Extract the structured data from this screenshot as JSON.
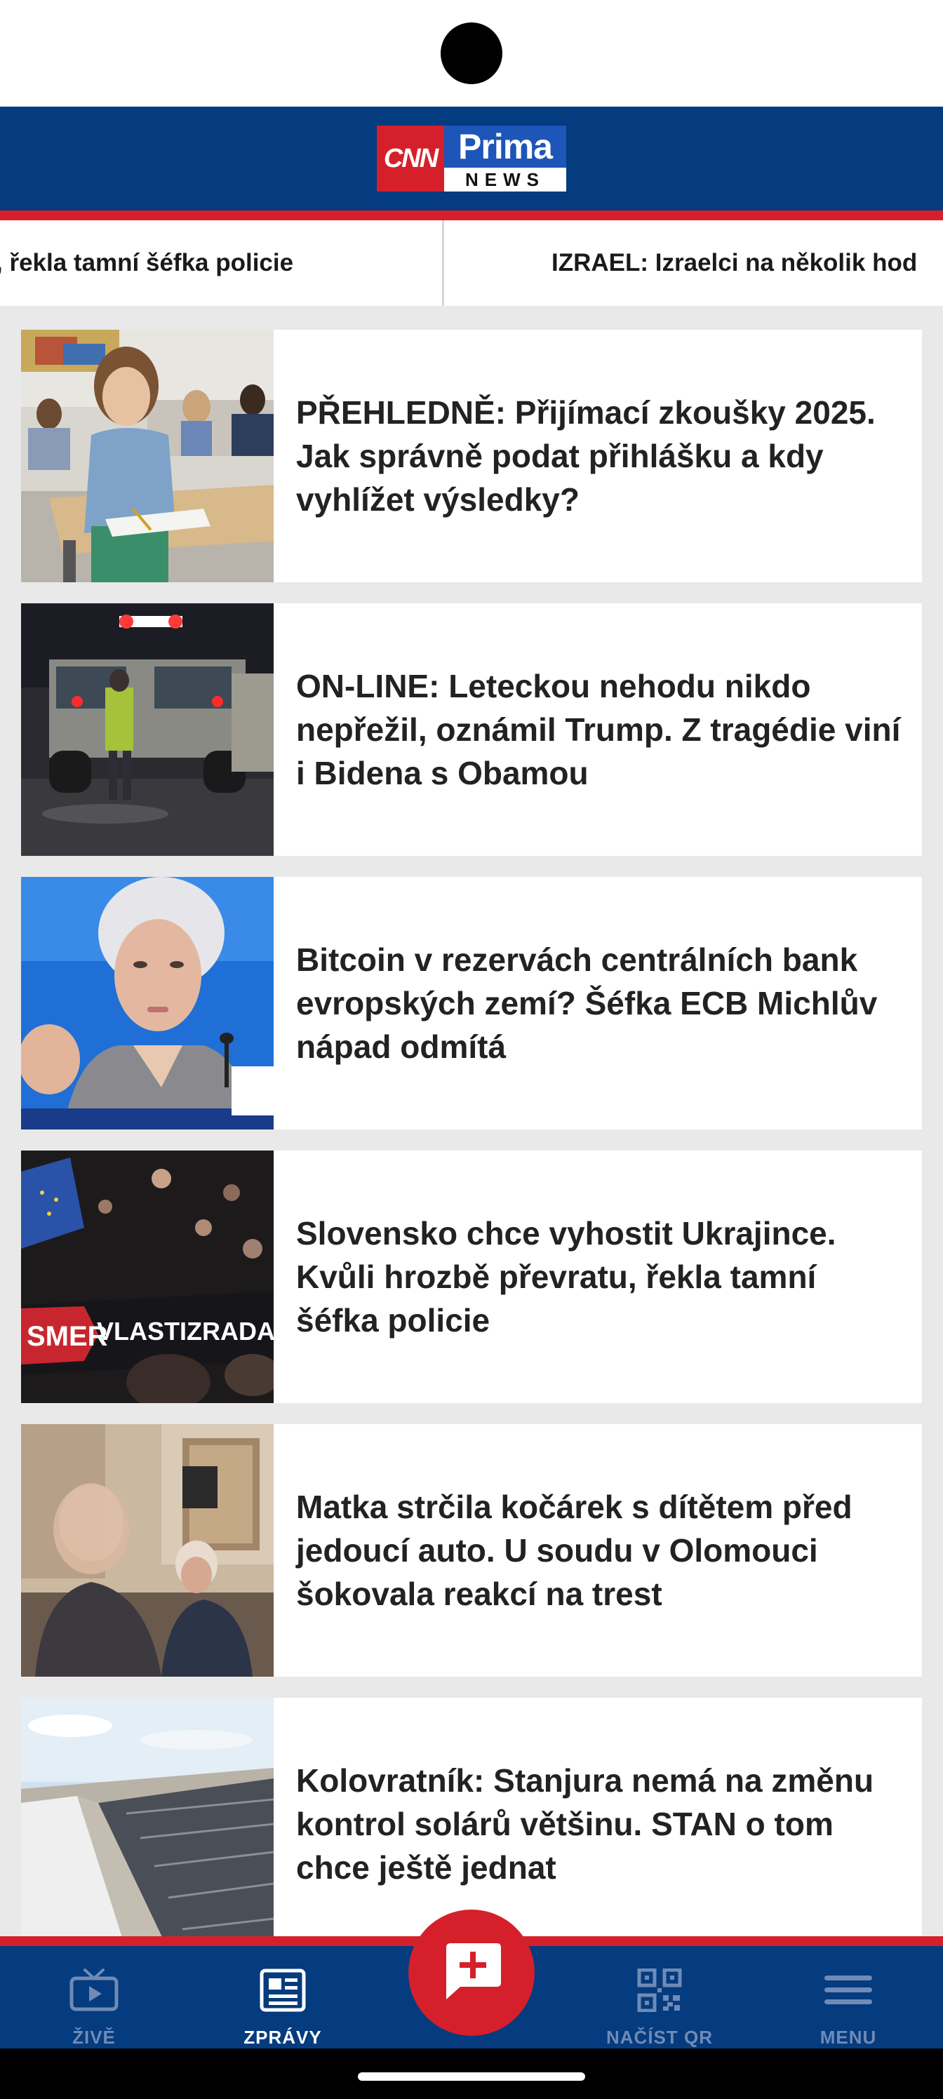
{
  "header": {
    "logo_cnn": "CNN",
    "logo_prima": "Prima",
    "logo_news": "NEWS"
  },
  "ticker": {
    "items": [
      ", řekla tamní šéfka policie",
      "IZRAEL: Izraelci na několik hod"
    ]
  },
  "articles": [
    {
      "title": "PŘEHLEDNĚ: Přijímací zkoušky 2025. Jak správně podat přihlášku a kdy vyhlížet výsledky?"
    },
    {
      "title": "ON-LINE: Leteckou nehodu nikdo nepřežil, oznámil Trump. Z tragédie viní i Bidena s Obamou"
    },
    {
      "title": "Bitcoin v rezervách centrálních bank evropských zemí? Šéfka ECB Michlův nápad odmítá"
    },
    {
      "title": "Slovensko chce vyhostit Ukrajince. Kvůli hrozbě převratu, řekla tamní šéfka policie"
    },
    {
      "title": "Matka strčila kočárek s dítětem před jedoucí auto. U soudu v Olomouci šokovala reakcí na trest"
    },
    {
      "title": "Kolovratník: Stanjura nemá na změnu kontrol solárů většinu. STAN o tom chce ještě jednat"
    }
  ],
  "image_texts": {
    "protest_sign_left": "SMER",
    "protest_sign_right": "VLASTIZRADA"
  },
  "bottom_nav": {
    "live": {
      "label": "ŽIVĚ",
      "icon": "tv-icon"
    },
    "news": {
      "label": "ZPRÁVY",
      "icon": "newspaper-icon",
      "active": true
    },
    "report": {
      "icon": "chat-plus-icon"
    },
    "qr": {
      "label": "NAČÍST QR",
      "icon": "qr-code-icon"
    },
    "menu": {
      "label": "MENU",
      "icon": "hamburger-menu-icon"
    }
  },
  "colors": {
    "brand_blue": "#053b7f",
    "brand_red": "#d5202b",
    "feed_background": "#e9e9e9",
    "nav_inactive": "#6f8bb6"
  }
}
